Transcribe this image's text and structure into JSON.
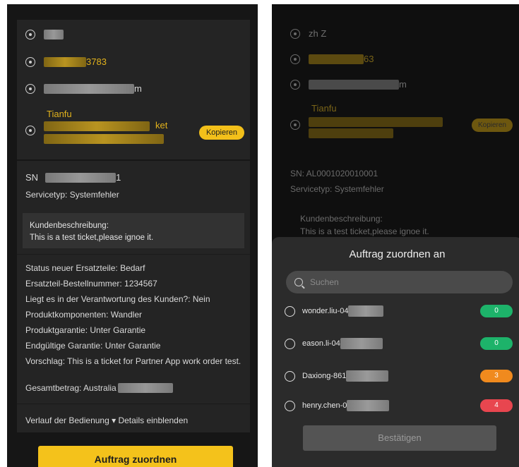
{
  "left": {
    "contact": {
      "phone_suffix": "3783",
      "email_suffix": "m",
      "address_label": "Tianfu",
      "address_suffix": "ket",
      "copy_label": "Kopieren"
    },
    "sn_label": "SN",
    "sn_suffix": "1",
    "service_type": "Servicetyp:  Systemfehler",
    "description_title": "Kundenbeschreibung:",
    "description_text": "This is a test ticket,please ignoe it.",
    "details": [
      "Status neuer Ersatzteile:  Bedarf",
      "Ersatzteil-Bestellnummer:  1234567",
      "Liegt es in der Verantwortung des Kunden?:  Nein",
      "Produktkomponenten:  Wandler",
      "Produktgarantie:  Unter Garantie",
      "Endgültige Garantie:  Unter Garantie",
      "Vorschlag:  This is a ticket for Partner App work order test.",
      "Gesamtbetrag:  Australia"
    ],
    "history_link": "Verlauf der Bedienung ▾ Details einblenden",
    "assign_button": "Auftrag zuordnen"
  },
  "right": {
    "name": "zh Z",
    "phone_suffix": "63",
    "email_suffix": "m",
    "address_label": "Tianfu",
    "copy_label": "Kopieren",
    "sn": "SN:  AL0001020010001",
    "service_type": "Servicetyp:  Systemfehler",
    "description_title": "Kundenbeschreibung:",
    "description_text": "This is a test ticket,please ignoe it.",
    "sheet_title": "Auftrag zuordnen an",
    "search_placeholder": "Suchen",
    "technicians": [
      {
        "name": "wonder.liu-04",
        "count": "0",
        "color": "#1db36a"
      },
      {
        "name": "eason.li-04",
        "count": "0",
        "color": "#1db36a"
      },
      {
        "name": "Daxiong-861",
        "count": "3",
        "color": "#f08a1e"
      },
      {
        "name": "henry.chen-0",
        "count": "4",
        "color": "#e8464f"
      }
    ],
    "confirm_button": "Bestätigen"
  }
}
